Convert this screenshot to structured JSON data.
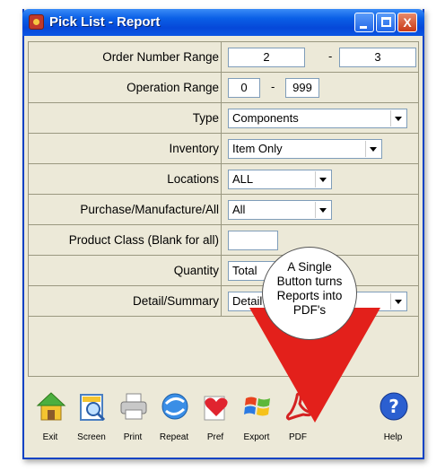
{
  "window": {
    "title": "Pick List - Report",
    "controls": {
      "minimize": "_",
      "maximize": "□",
      "close": "X"
    }
  },
  "form": {
    "order_number_range": {
      "label": "Order Number Range",
      "from": "2",
      "separator": "-",
      "to": "3"
    },
    "operation_range": {
      "label": "Operation Range",
      "from": "0",
      "separator": "-",
      "to": "999"
    },
    "type": {
      "label": "Type",
      "value": "Components"
    },
    "inventory": {
      "label": "Inventory",
      "value": "Item Only"
    },
    "locations": {
      "label": "Locations",
      "value": "ALL"
    },
    "purchase_manufacture": {
      "label": "Purchase/Manufacture/All",
      "value": "All"
    },
    "product_class": {
      "label": "Product Class (Blank for all)",
      "value": ""
    },
    "quantity": {
      "label": "Quantity",
      "value": "Total"
    },
    "detail_summary": {
      "label": "Detail/Summary",
      "value": "Detail"
    }
  },
  "toolbar": {
    "exit": "Exit",
    "screen": "Screen",
    "print": "Print",
    "repeat": "Repeat",
    "pref": "Pref",
    "export": "Export",
    "pdf": "PDF",
    "help": "Help"
  },
  "callout": {
    "line1": "A Single",
    "line2": "Button turns",
    "line3": "Reports into",
    "line4": "PDF's"
  },
  "colors": {
    "titlebar": "#0a55e2",
    "window_body": "#ece9d8",
    "arrow": "#e3201b",
    "close_button": "#c93a17"
  },
  "icons": {
    "app": "app-icon",
    "exit": "house-icon",
    "screen": "screen-preview-icon",
    "print": "printer-icon",
    "repeat": "repeat-globe-icon",
    "pref": "heart-preferences-icon",
    "export": "windows-flag-icon",
    "pdf": "acrobat-pdf-icon",
    "help": "help-question-icon"
  }
}
